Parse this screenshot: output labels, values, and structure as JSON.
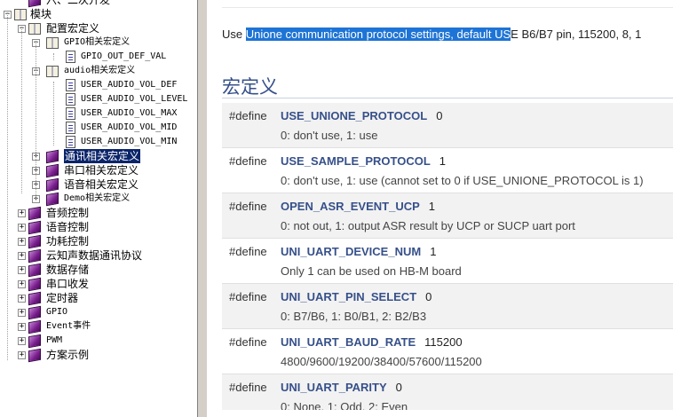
{
  "tree": {
    "items": [
      {
        "label": "六、二次开发",
        "icon": "book-closed-icon",
        "expander": "",
        "level": 1
      },
      {
        "label": "模块",
        "icon": "book-open-icon",
        "expander": "−",
        "level": 0
      },
      {
        "label": "配置宏定义",
        "icon": "book-open-icon",
        "expander": "−",
        "level": 1
      },
      {
        "label": "GPIO相关宏定义",
        "icon": "book-open-icon",
        "expander": "−",
        "level": 2
      },
      {
        "label": "GPIO_OUT_DEF_VAL",
        "icon": "page-icon",
        "expander": "",
        "level": 3
      },
      {
        "label": "audio相关宏定义",
        "icon": "book-open-icon",
        "expander": "−",
        "level": 2
      },
      {
        "label": "USER_AUDIO_VOL_DEF",
        "icon": "page-icon",
        "expander": "",
        "level": 3
      },
      {
        "label": "USER_AUDIO_VOL_LEVEL",
        "icon": "page-icon",
        "expander": "",
        "level": 3
      },
      {
        "label": "USER_AUDIO_VOL_MAX",
        "icon": "page-icon",
        "expander": "",
        "level": 3
      },
      {
        "label": "USER_AUDIO_VOL_MID",
        "icon": "page-icon",
        "expander": "",
        "level": 3
      },
      {
        "label": "USER_AUDIO_VOL_MIN",
        "icon": "page-icon",
        "expander": "",
        "level": 3
      },
      {
        "label": "通讯相关宏定义",
        "icon": "book-closed-icon",
        "expander": "+",
        "level": 2,
        "selected": true
      },
      {
        "label": "串口相关宏定义",
        "icon": "book-closed-icon",
        "expander": "+",
        "level": 2
      },
      {
        "label": "语音相关宏定义",
        "icon": "book-closed-icon",
        "expander": "+",
        "level": 2
      },
      {
        "label": "Demo相关宏定义",
        "icon": "book-closed-icon",
        "expander": "+",
        "level": 2
      },
      {
        "label": "音频控制",
        "icon": "book-closed-icon",
        "expander": "+",
        "level": 1
      },
      {
        "label": "语音控制",
        "icon": "book-closed-icon",
        "expander": "+",
        "level": 1
      },
      {
        "label": "功耗控制",
        "icon": "book-closed-icon",
        "expander": "+",
        "level": 1
      },
      {
        "label": "云知声数据通讯协议",
        "icon": "book-closed-icon",
        "expander": "+",
        "level": 1
      },
      {
        "label": "数据存储",
        "icon": "book-closed-icon",
        "expander": "+",
        "level": 1
      },
      {
        "label": "串口收发",
        "icon": "book-closed-icon",
        "expander": "+",
        "level": 1
      },
      {
        "label": "定时器",
        "icon": "book-closed-icon",
        "expander": "+",
        "level": 1
      },
      {
        "label": "GPIO",
        "icon": "book-closed-icon",
        "expander": "+",
        "level": 1
      },
      {
        "label": "Event事件",
        "icon": "book-closed-icon",
        "expander": "+",
        "level": 1
      },
      {
        "label": "PWM",
        "icon": "book-closed-icon",
        "expander": "+",
        "level": 1
      },
      {
        "label": "方案示例",
        "icon": "book-closed-icon",
        "expander": "+",
        "level": 1
      }
    ]
  },
  "content": {
    "intro_before": "Use ",
    "intro_highlight": "Unione communication protocol settings, default US",
    "intro_after": "E B6/B7 pin, 115200, 8, 1",
    "section_title": "宏定义",
    "define_keyword": "#define",
    "defines": [
      {
        "name": "USE_UNIONE_PROTOCOL",
        "value": "0",
        "desc": "0: don't use, 1: use"
      },
      {
        "name": "USE_SAMPLE_PROTOCOL",
        "value": "1",
        "desc": "0: don't use, 1: use (cannot set to 0 if USE_UNIONE_PROTOCOL is 1)"
      },
      {
        "name": "OPEN_ASR_EVENT_UCP",
        "value": "1",
        "desc": "0: not out, 1: output ASR result by UCP or SUCP uart port"
      },
      {
        "name": "UNI_UART_DEVICE_NUM",
        "value": "1",
        "desc": "Only 1 can be used on HB-M board"
      },
      {
        "name": "UNI_UART_PIN_SELECT",
        "value": "0",
        "desc": "0: B7/B6, 1: B0/B1, 2: B2/B3"
      },
      {
        "name": "UNI_UART_BAUD_RATE",
        "value": "115200",
        "desc": "4800/9600/19200/38400/57600/115200"
      },
      {
        "name": "UNI_UART_PARITY",
        "value": "0",
        "desc": "0: None, 1: Odd, 2: Even"
      }
    ]
  },
  "colors": {
    "selection": "#0a246a",
    "highlight": "#1e74d6",
    "heading": "#36508a"
  }
}
